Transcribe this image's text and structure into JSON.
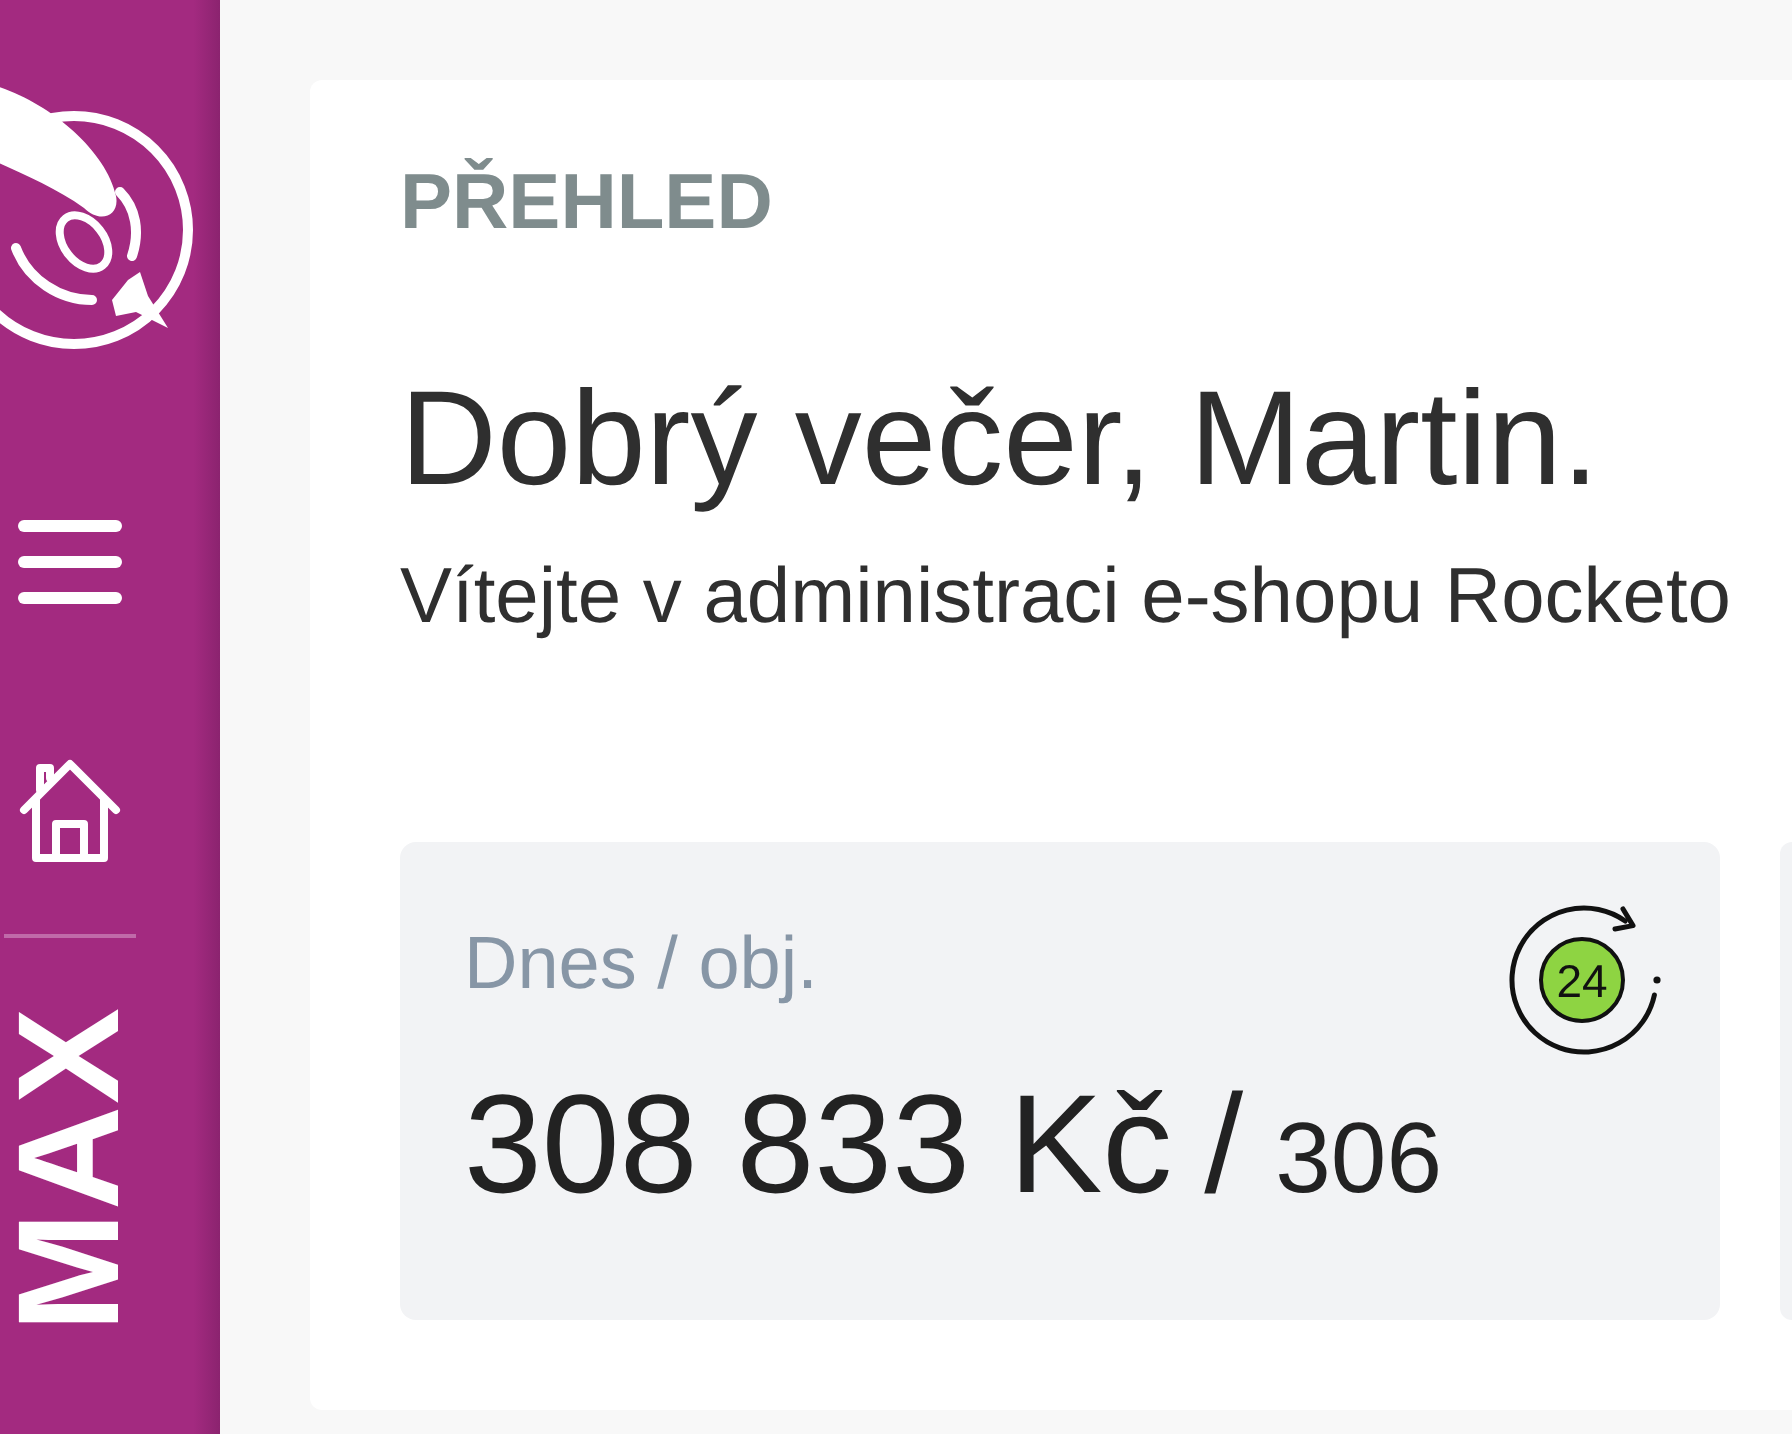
{
  "sidebar": {
    "label": "MAX"
  },
  "overview": {
    "section": "PŘEHLED",
    "greeting": "Dobrý večer, Martin.",
    "subtitle": "Vítejte v administraci e-shopu Rocketo"
  },
  "stats": [
    {
      "label": "Dnes / obj.",
      "amount": "308 833 Kč",
      "separator": "/",
      "count": "306",
      "icon_text": "24"
    }
  ]
}
